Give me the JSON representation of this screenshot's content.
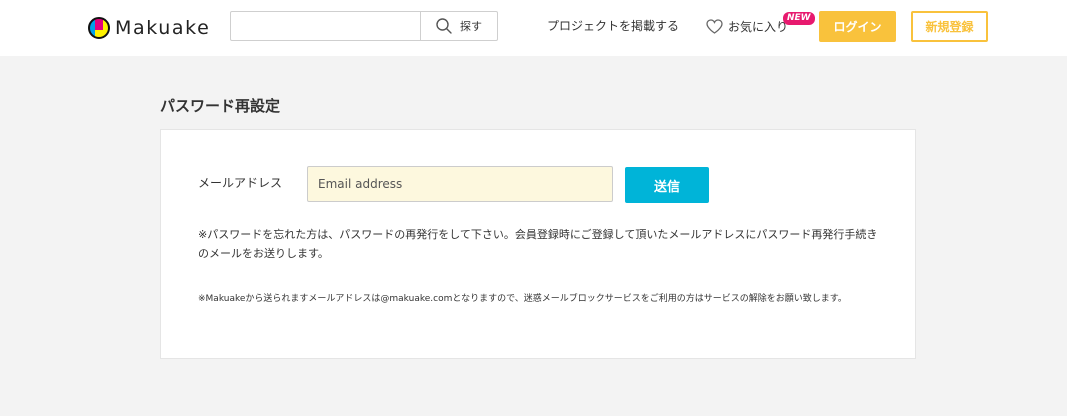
{
  "header": {
    "logo_text": "Makuake",
    "search": {
      "placeholder": "",
      "button_label": "探す"
    },
    "nav": {
      "post_project": "プロジェクトを掲載する",
      "favorites": "お気に入り",
      "new_badge": "NEW",
      "login": "ログイン",
      "register": "新規登録"
    }
  },
  "main": {
    "title": "パスワード再設定",
    "form": {
      "email_label": "メールアドレス",
      "email_placeholder": "Email address",
      "email_value": "",
      "submit_label": "送信"
    },
    "notes": {
      "main": "※パスワードを忘れた方は、パスワードの再発行をして下さい。会員登録時にご登録して頂いたメールアドレスにパスワード再発行手続きのメールをお送りします。",
      "sub": "※Makuakeから送られますメールアドレスは@makuake.comとなりますので、迷惑メールブロックサービスをご利用の方はサービスの解除をお願い致します。"
    }
  },
  "colors": {
    "accent_yellow": "#f9c23c",
    "send_blue": "#00b4d8",
    "badge_pink": "#e7196e",
    "input_bg": "#fdf8de",
    "page_bg": "#f3f3f3"
  }
}
